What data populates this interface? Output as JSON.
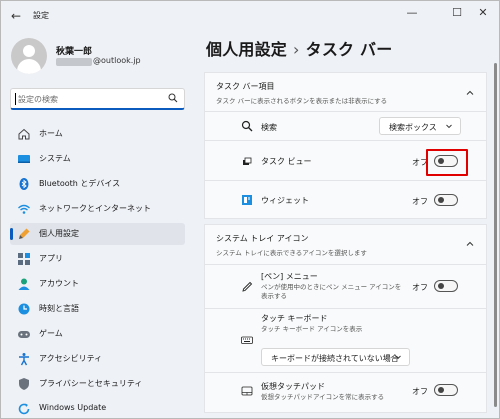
{
  "window": {
    "title": "設定",
    "back_icon": "back-arrow-icon",
    "controls": [
      "minimize-icon",
      "maximize-icon",
      "close-icon"
    ]
  },
  "user": {
    "name": "秋葉一郎",
    "email_domain": "@outlook.jp"
  },
  "search": {
    "placeholder": "設定の検索"
  },
  "sidebar": {
    "items": [
      {
        "label": "ホーム",
        "icon": "home-icon",
        "active": false
      },
      {
        "label": "システム",
        "icon": "system-icon",
        "active": false
      },
      {
        "label": "Bluetooth とデバイス",
        "icon": "bluetooth-icon",
        "active": false
      },
      {
        "label": "ネットワークとインターネット",
        "icon": "network-icon",
        "active": false
      },
      {
        "label": "個人用設定",
        "icon": "personalization-icon",
        "active": true
      },
      {
        "label": "アプリ",
        "icon": "apps-icon",
        "active": false
      },
      {
        "label": "アカウント",
        "icon": "account-icon",
        "active": false
      },
      {
        "label": "時刻と言語",
        "icon": "time-language-icon",
        "active": false
      },
      {
        "label": "ゲーム",
        "icon": "gaming-icon",
        "active": false
      },
      {
        "label": "アクセシビリティ",
        "icon": "accessibility-icon",
        "active": false
      },
      {
        "label": "プライバシーとセキュリティ",
        "icon": "privacy-shield-icon",
        "active": false
      },
      {
        "label": "Windows Update",
        "icon": "windows-update-icon",
        "active": false
      }
    ]
  },
  "breadcrumb": {
    "parent": "個人用設定",
    "separator": "›",
    "current": "タスク バー"
  },
  "taskbar_items": {
    "title": "タスク バー項目",
    "subtitle": "タスク バーに表示されるボタンを表示または非表示にする",
    "rows": [
      {
        "label": "検索",
        "icon": "search-icon",
        "control": "dropdown",
        "value": "検索ボックス"
      },
      {
        "label": "タスク ビュー",
        "icon": "task-view-icon",
        "control": "toggle",
        "state": "オフ",
        "on": false
      },
      {
        "label": "ウィジェット",
        "icon": "widgets-icon",
        "control": "toggle",
        "state": "オフ",
        "on": false
      }
    ]
  },
  "system_tray": {
    "title": "システム トレイ アイコン",
    "subtitle": "システム トレイに表示できるアイコンを選択します",
    "rows": [
      {
        "label": "[ペン] メニュー",
        "sub": "ペンが使用中のときにペン メニュー アイコンを表示する",
        "icon": "pen-icon",
        "state": "オフ",
        "on": false
      },
      {
        "label": "タッチ キーボード",
        "sub": "タッチ キーボード アイコンを表示",
        "icon": "keyboard-icon",
        "dropdown": "キーボードが接続されていない場合"
      },
      {
        "label": "仮想タッチパッド",
        "sub": "仮想タッチパッドアイコンを常に表示する",
        "icon": "touchpad-icon",
        "state": "オフ",
        "on": false
      }
    ]
  },
  "colors": {
    "accent": "#0a5bbd",
    "highlight_box": "#e00000"
  }
}
